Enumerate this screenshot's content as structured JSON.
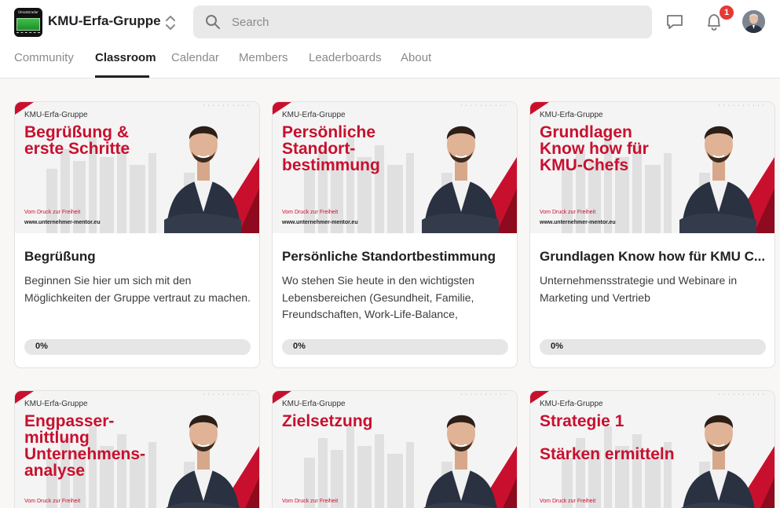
{
  "header": {
    "logo_text": "Umsatzradar",
    "group_name": "KMU-Erfa-Gruppe",
    "search_placeholder": "Search",
    "notification_count": "1"
  },
  "tabs": [
    {
      "label": "Community",
      "active": false
    },
    {
      "label": "Classroom",
      "active": true
    },
    {
      "label": "Calendar",
      "active": false
    },
    {
      "label": "Members",
      "active": false
    },
    {
      "label": "Leaderboards",
      "active": false
    },
    {
      "label": "About",
      "active": false
    }
  ],
  "colors": {
    "brand_red": "#c8102e",
    "progress_track": "#e6e6e6"
  },
  "courses": [
    {
      "brand": "KMU-Erfa-Gruppe",
      "headline": [
        "Begrüßung &",
        "erste Schritte"
      ],
      "tagline": "Vom Druck zur Freiheit",
      "website": "www.unternehmer-mentor.eu",
      "title": "Begrüßung",
      "description": "Beginnen Sie hier um sich mit den Möglichkeiten der Gruppe vertraut zu machen.",
      "progress": 0,
      "progress_label": "0%"
    },
    {
      "brand": "KMU-Erfa-Gruppe",
      "headline": [
        "Persönliche",
        "Standort-",
        "bestimmung"
      ],
      "tagline": "Vom Druck zur Freiheit",
      "website": "www.unternehmer-mentor.eu",
      "title": "Persönliche Standortbestimmung",
      "description": "Wo stehen Sie heute in den wichtigsten Lebensbereichen (Gesundheit, Familie, Freundschaften, Work-Life-Balance,",
      "progress": 0,
      "progress_label": "0%"
    },
    {
      "brand": "KMU-Erfa-Gruppe",
      "headline": [
        "Grundlagen",
        "Know how für",
        "KMU-Chefs"
      ],
      "tagline": "Vom Druck zur Freiheit",
      "website": "www.unternehmer-mentor.eu",
      "title": "Grundlagen Know how für KMU C...",
      "description": "Unternehmensstrategie und Webinare in Marketing und Vertrieb",
      "progress": 0,
      "progress_label": "0%"
    },
    {
      "brand": "KMU-Erfa-Gruppe",
      "headline": [
        "Engpasser-",
        "mittlung",
        "Unternehmens-",
        "analyse"
      ],
      "tagline": "Vom Druck zur Freiheit",
      "website": "",
      "title": "",
      "description": "",
      "progress": 0,
      "progress_label": ""
    },
    {
      "brand": "KMU-Erfa-Gruppe",
      "headline": [
        "Zielsetzung"
      ],
      "tagline": "Vom Druck zur Freiheit",
      "website": "",
      "title": "",
      "description": "",
      "progress": 0,
      "progress_label": ""
    },
    {
      "brand": "KMU-Erfa-Gruppe",
      "headline": [
        "Strategie 1",
        "",
        "Stärken ermitteln"
      ],
      "tagline": "Vom Druck zur Freiheit",
      "website": "",
      "title": "",
      "description": "",
      "progress": 0,
      "progress_label": ""
    }
  ]
}
